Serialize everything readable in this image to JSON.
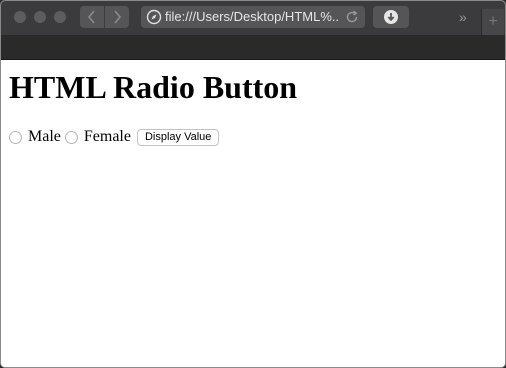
{
  "browser": {
    "url": "file:///Users/Desktop/HTML%...",
    "overflow_label": "»",
    "newtab_label": "+"
  },
  "page": {
    "heading": "HTML Radio Button",
    "radios": [
      {
        "label": "Male",
        "checked": false
      },
      {
        "label": "Female",
        "checked": false
      }
    ],
    "button_label": "Display Value"
  }
}
